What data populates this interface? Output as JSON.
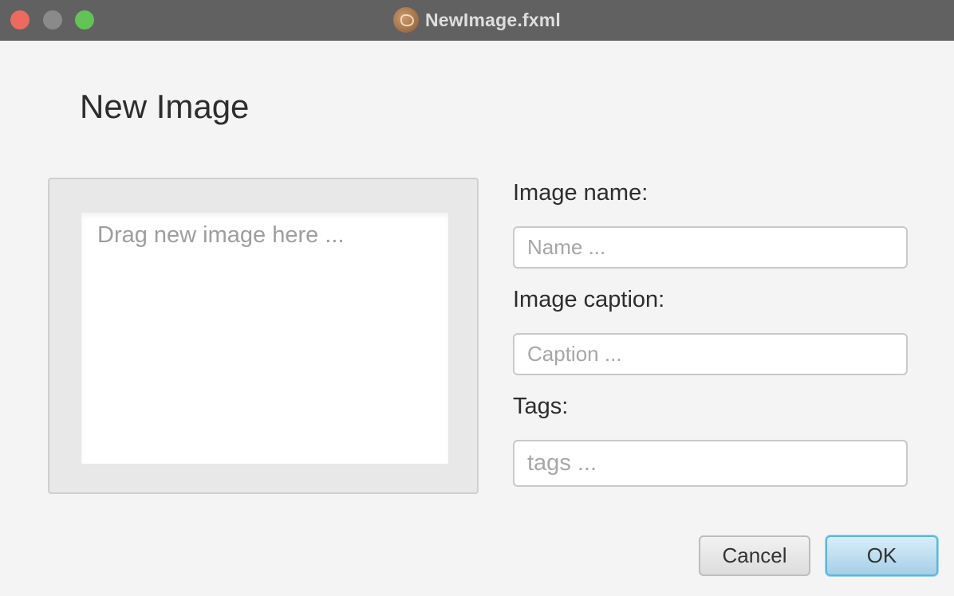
{
  "window": {
    "title": "NewImage.fxml",
    "app_icon": "app-icon"
  },
  "dialog": {
    "heading": "New Image",
    "drop_area": {
      "placeholder": "Drag new image here ..."
    },
    "fields": {
      "name": {
        "label": "Image name:",
        "placeholder": "Name ...",
        "value": ""
      },
      "caption": {
        "label": "Image caption:",
        "placeholder": "Caption ...",
        "value": ""
      },
      "tags": {
        "label": "Tags:",
        "placeholder": "tags ...",
        "value": ""
      }
    },
    "buttons": {
      "cancel": "Cancel",
      "ok": "OK"
    }
  },
  "colors": {
    "titlebar": "#616161",
    "close": "#ec6a5e",
    "minimize": "#8a8a8a",
    "zoom": "#61c454",
    "ok_button": "#a6cfe6"
  }
}
